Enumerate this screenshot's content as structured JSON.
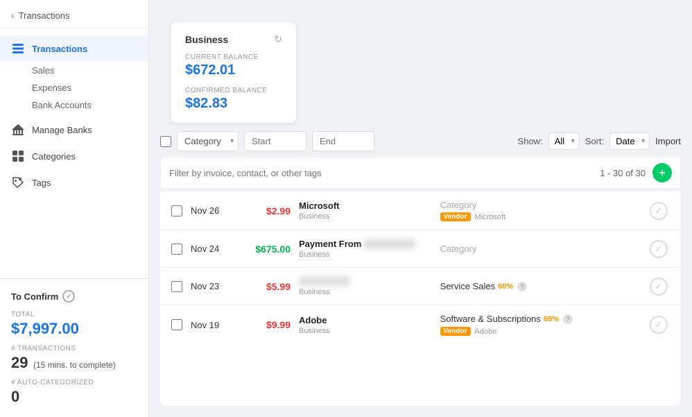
{
  "sidebar": {
    "back_label": "Transactions",
    "nav": [
      {
        "id": "transactions",
        "label": "Transactions",
        "active": true,
        "icon": "list-icon"
      },
      {
        "id": "sales",
        "label": "Sales",
        "sub": true
      },
      {
        "id": "expenses",
        "label": "Expenses",
        "sub": true
      },
      {
        "id": "bank-accounts",
        "label": "Bank Accounts",
        "sub": true
      },
      {
        "id": "manage-banks",
        "label": "Manage Banks",
        "icon": "bank-icon"
      },
      {
        "id": "categories",
        "label": "Categories",
        "icon": "grid-icon"
      },
      {
        "id": "tags",
        "label": "Tags",
        "icon": "tag-icon"
      }
    ]
  },
  "to_confirm": {
    "header": "To Confirm",
    "total_label": "TOTAL",
    "total_value": "$7,997.00",
    "transactions_label": "# TRANSACTIONS",
    "transactions_value": "29",
    "transactions_sub": "(15 mins. to complete)",
    "auto_label": "# AUTO-CATEGORIZED",
    "auto_value": "0"
  },
  "account_card": {
    "name": "Business",
    "current_balance_label": "CURRENT BALANCE",
    "current_balance": "$672.01",
    "confirmed_balance_label": "CONFIRMED BALANCE",
    "confirmed_balance": "$82.83"
  },
  "toolbar": {
    "category_placeholder": "Category",
    "start_placeholder": "Start",
    "end_placeholder": "End",
    "show_label": "Show:",
    "show_value": "All",
    "sort_label": "Sort:",
    "sort_value": "Date",
    "import_label": "Import"
  },
  "filter_bar": {
    "placeholder": "Filter by invoice, contact, or other tags",
    "pagination": "1 - 30 of 30"
  },
  "transactions": [
    {
      "date": "Nov 26",
      "amount": "$2.99",
      "amount_type": "negative",
      "merchant": "Microsoft",
      "merchant_sub": "Business",
      "category": "Category",
      "category_type": "placeholder",
      "vendor_badge": "Vendor",
      "vendor_name": "Microsoft"
    },
    {
      "date": "Nov 24",
      "amount": "$675.00",
      "amount_type": "positive",
      "merchant": "Payment From",
      "merchant_blurred": "████████",
      "merchant_sub": "Business",
      "category": "Category",
      "category_type": "placeholder"
    },
    {
      "date": "Nov 23",
      "amount": "$5.99",
      "amount_type": "negative",
      "merchant": "",
      "merchant_blurred": "████████",
      "merchant_sub": "Business",
      "category": "Service Sales",
      "category_type": "named",
      "pct": "60%",
      "pct_type": "orange"
    },
    {
      "date": "Nov 19",
      "amount": "$9.99",
      "amount_type": "negative",
      "merchant": "Adobe",
      "merchant_sub": "Business",
      "category": "Software & Subscriptions",
      "category_type": "named",
      "pct": "69%",
      "pct_type": "orange",
      "vendor_badge": "Vendor",
      "vendor_name": "Adobe"
    }
  ]
}
